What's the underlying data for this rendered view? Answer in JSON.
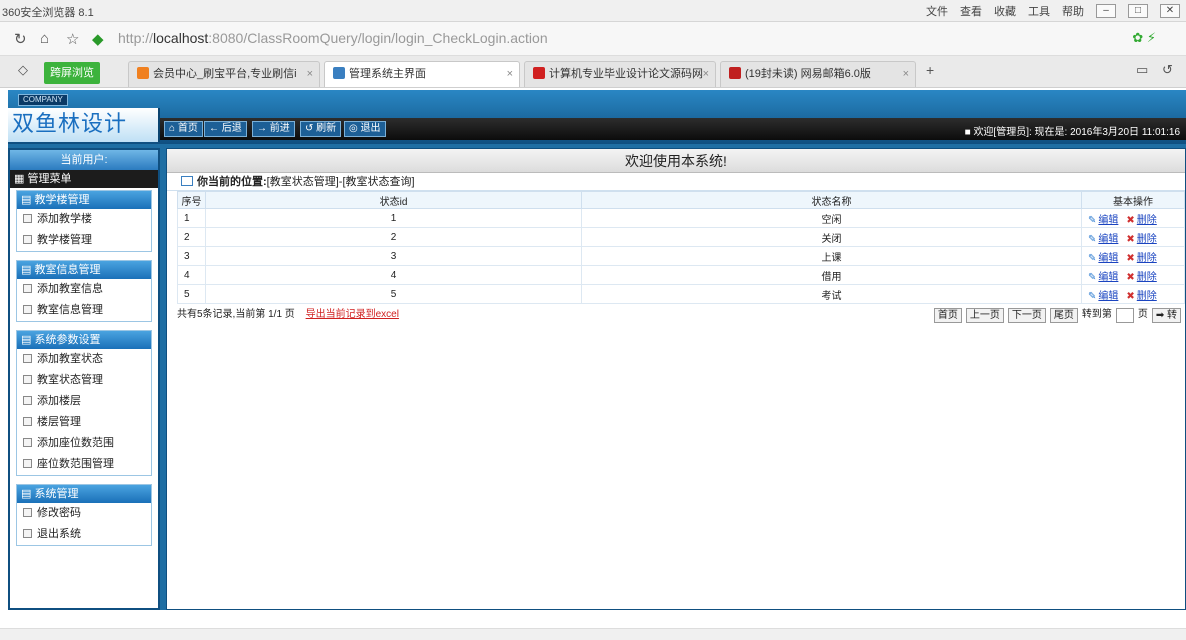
{
  "browser": {
    "app_title": "360安全浏览器 8.1",
    "menu": [
      "文件",
      "查看",
      "收藏",
      "工具",
      "帮助"
    ],
    "url_prefix": "http://",
    "url_host": "localhost",
    "url_rest": ":8080/ClassRoomQuery/login/login_CheckLogin.action",
    "green_tab": "跨屏浏览",
    "tabs": [
      {
        "label": "会员中心_刷宝平台,专业刷信i",
        "active": false
      },
      {
        "label": "管理系统主界面",
        "active": true
      },
      {
        "label": "计算机专业毕业设计论文源码网",
        "active": false
      },
      {
        "label": "(19封未读) 网易邮箱6.0版",
        "active": false
      }
    ]
  },
  "header": {
    "company": "COMPANY",
    "logo": "双鱼林设计",
    "toolbar": [
      "首页",
      "后退",
      "前进",
      "刷新",
      "退出"
    ],
    "welcome": "欢迎[管理员]:  现在是: 2016年3月20日 11:01:16"
  },
  "sidebar": {
    "current_user": "当前用户:",
    "menu_head": "管理菜单",
    "groups": [
      {
        "title": "教学楼管理",
        "items": [
          "添加教学楼",
          "教学楼管理"
        ]
      },
      {
        "title": "教室信息管理",
        "items": [
          "添加教室信息",
          "教室信息管理"
        ]
      },
      {
        "title": "系统参数设置",
        "items": [
          "添加教室状态",
          "教室状态管理",
          "添加楼层",
          "楼层管理",
          "添加座位数范围",
          "座位数范围管理"
        ]
      },
      {
        "title": "系统管理",
        "items": [
          "修改密码",
          "退出系统"
        ]
      }
    ]
  },
  "main": {
    "title": "欢迎使用本系统!",
    "position_label": "你当前的位置:",
    "position_path": "[教室状态管理]-[教室状态查询]",
    "columns": [
      "序号",
      "状态id",
      "状态名称",
      "基本操作"
    ],
    "rows": [
      {
        "no": "1",
        "id": "1",
        "name": "空闲"
      },
      {
        "no": "2",
        "id": "2",
        "name": "关闭"
      },
      {
        "no": "3",
        "id": "3",
        "name": "上课"
      },
      {
        "no": "4",
        "id": "4",
        "name": "借用"
      },
      {
        "no": "5",
        "id": "5",
        "name": "考试"
      }
    ],
    "edit_label": "编辑",
    "delete_label": "删除",
    "pager_info": "共有5条记录,当前第 1/1 页",
    "export_label": "导出当前记录到excel",
    "pager_buttons": [
      "首页",
      "上一页",
      "下一页",
      "尾页"
    ],
    "goto_label": "转到第",
    "page_label": "页",
    "go_label": "转"
  }
}
